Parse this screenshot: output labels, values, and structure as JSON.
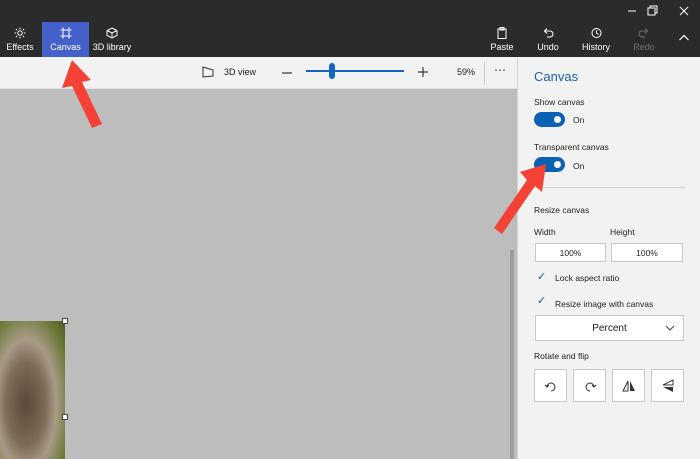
{
  "ribbon": {
    "items": [
      {
        "label": "Effects",
        "icon": "sun-icon"
      },
      {
        "label": "Canvas",
        "icon": "canvas-icon",
        "active": true
      },
      {
        "label": "3D library",
        "icon": "cube-icon"
      },
      {
        "label": "Paste",
        "icon": "paste-icon"
      },
      {
        "label": "Undo",
        "icon": "undo-icon"
      },
      {
        "label": "History",
        "icon": "history-icon"
      },
      {
        "label": "Redo",
        "icon": "redo-icon",
        "disabled": true
      }
    ]
  },
  "toolbar": {
    "view_label": "3D view",
    "zoom_value": "59%",
    "zoom_level": 0.27
  },
  "panel": {
    "title": "Canvas",
    "show_canvas": {
      "label": "Show canvas",
      "state": "On"
    },
    "transparent_canvas": {
      "label": "Transparent canvas",
      "state": "On"
    },
    "resize_heading": "Resize canvas",
    "width_label": "Width",
    "height_label": "Height",
    "width_value": "100%",
    "height_value": "100%",
    "lock_aspect": "Lock aspect ratio",
    "resize_with_canvas": "Resize image with canvas",
    "unit_select": "Percent",
    "rotate_heading": "Rotate and flip"
  },
  "colors": {
    "ribbon_bg": "#2b2b2b",
    "accent": "#4561c9",
    "toggle_on": "#0b61b3",
    "annotation_arrow": "#f44336"
  }
}
